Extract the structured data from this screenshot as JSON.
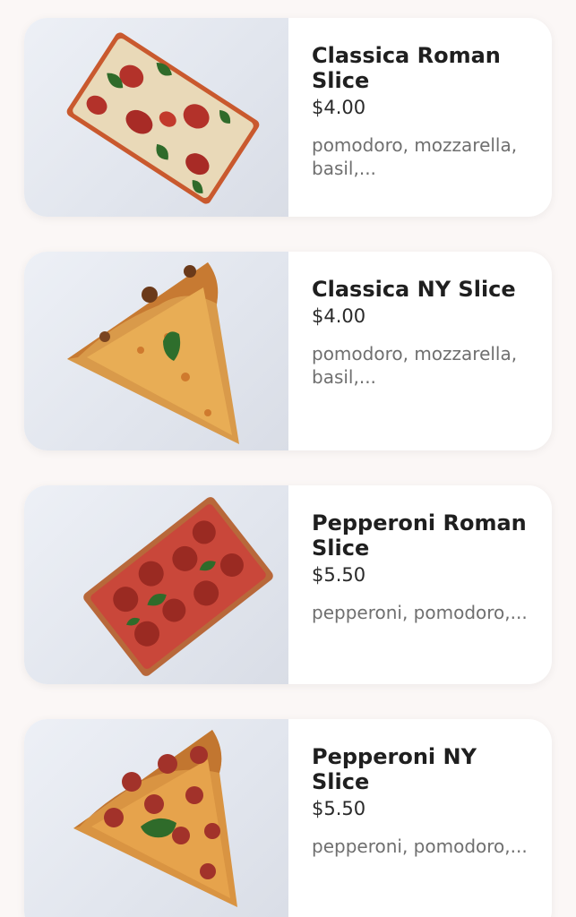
{
  "menu_items": [
    {
      "title": "Classica Roman Slice",
      "price": "$4.00",
      "description": "pomodoro, mozzarella, basil,...",
      "image": "roman-margherita-slice-photo"
    },
    {
      "title": "Classica NY Slice",
      "price": "$4.00",
      "description": "pomodoro, mozzarella, basil,...",
      "image": "ny-cheese-slice-photo"
    },
    {
      "title": "Pepperoni Roman Slice",
      "price": "$5.50",
      "description": "pepperoni, pomodoro,...",
      "image": "roman-pepperoni-slice-photo"
    },
    {
      "title": "Pepperoni NY Slice",
      "price": "$5.50",
      "description": "pepperoni, pomodoro,...",
      "image": "ny-pepperoni-slice-photo"
    }
  ]
}
